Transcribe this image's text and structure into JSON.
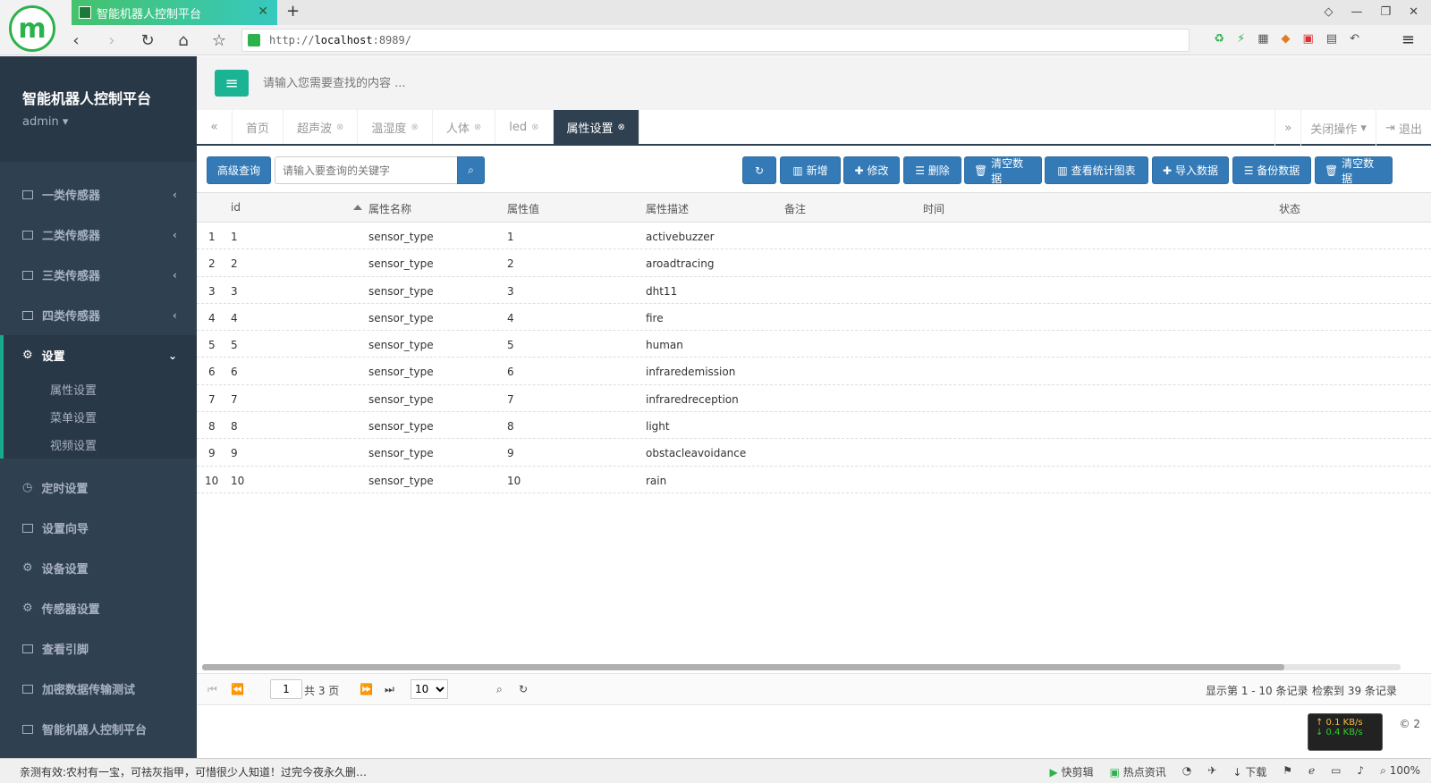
{
  "browser": {
    "tab_title": "智能机器人控制平台",
    "url_prefix": "http://",
    "url_host": "localhost",
    "url_suffix": ":8989/",
    "tab_close": "✕",
    "new_tab": "+"
  },
  "sidebar": {
    "brand_title": "智能机器人控制平台",
    "user": "admin",
    "items": [
      {
        "label": "一类传感器"
      },
      {
        "label": "二类传感器"
      },
      {
        "label": "三类传感器"
      },
      {
        "label": "四类传感器"
      }
    ],
    "active_group": {
      "label": "设置",
      "subitems": [
        "属性设置",
        "菜单设置",
        "视频设置"
      ]
    },
    "items_after": [
      {
        "label": "定时设置"
      },
      {
        "label": "设置向导"
      },
      {
        "label": "设备设置"
      },
      {
        "label": "传感器设置"
      },
      {
        "label": "查看引脚"
      },
      {
        "label": "加密数据传输测试"
      },
      {
        "label": "智能机器人控制平台"
      }
    ]
  },
  "topbar": {
    "search_placeholder": "请输入您需要查找的内容 ..."
  },
  "page_tabs": [
    {
      "label": "首页",
      "closable": false
    },
    {
      "label": "超声波",
      "closable": true
    },
    {
      "label": "温湿度",
      "closable": true
    },
    {
      "label": "人体",
      "closable": true
    },
    {
      "label": "led",
      "closable": true
    },
    {
      "label": "属性设置",
      "closable": true,
      "active": true
    }
  ],
  "tab_actions": {
    "close_ops": "关闭操作",
    "logout": "退出"
  },
  "toolbar": {
    "advanced_search": "高级查询",
    "keyword_placeholder": "请输入要查询的关键字",
    "buttons": [
      "新增",
      "修改",
      "删除",
      "清空数据",
      "查看统计图表",
      "导入数据",
      "备份数据",
      "清空数据"
    ]
  },
  "table": {
    "headers": [
      "id",
      "属性名称",
      "属性值",
      "属性描述",
      "备注",
      "时间",
      "状态"
    ],
    "rows": [
      {
        "n": "1",
        "id": "1",
        "name": "sensor_type",
        "value": "1",
        "desc": "activebuzzer"
      },
      {
        "n": "2",
        "id": "2",
        "name": "sensor_type",
        "value": "2",
        "desc": "aroadtracing"
      },
      {
        "n": "3",
        "id": "3",
        "name": "sensor_type",
        "value": "3",
        "desc": "dht11"
      },
      {
        "n": "4",
        "id": "4",
        "name": "sensor_type",
        "value": "4",
        "desc": "fire"
      },
      {
        "n": "5",
        "id": "5",
        "name": "sensor_type",
        "value": "5",
        "desc": "human"
      },
      {
        "n": "6",
        "id": "6",
        "name": "sensor_type",
        "value": "6",
        "desc": "infraredemission"
      },
      {
        "n": "7",
        "id": "7",
        "name": "sensor_type",
        "value": "7",
        "desc": "infraredreception"
      },
      {
        "n": "8",
        "id": "8",
        "name": "sensor_type",
        "value": "8",
        "desc": "light"
      },
      {
        "n": "9",
        "id": "9",
        "name": "sensor_type",
        "value": "9",
        "desc": "obstacleavoidance"
      },
      {
        "n": "10",
        "id": "10",
        "name": "sensor_type",
        "value": "10",
        "desc": "rain"
      }
    ]
  },
  "pager": {
    "current_page": "1",
    "total_pages": "共 3 页",
    "page_size": "10",
    "showing": "显示第 1 - 10 条记录",
    "total": "检索到 39 条记录"
  },
  "footer": {
    "copyright": "© 2"
  },
  "netspeed": {
    "up": "↑ 0.1 KB/s",
    "down": "↓ 0.4 KB/s"
  },
  "statusbar": {
    "news": "亲测有效:农村有一宝，可祛灰指甲，可惜很少人知道！过完今夜永久删…",
    "right": [
      "快剪辑",
      "热点资讯",
      "下载",
      "100%"
    ]
  },
  "colors": {
    "sidebar": "#2f4050",
    "accent": "#1ab394",
    "primary_btn": "#337ab7"
  }
}
